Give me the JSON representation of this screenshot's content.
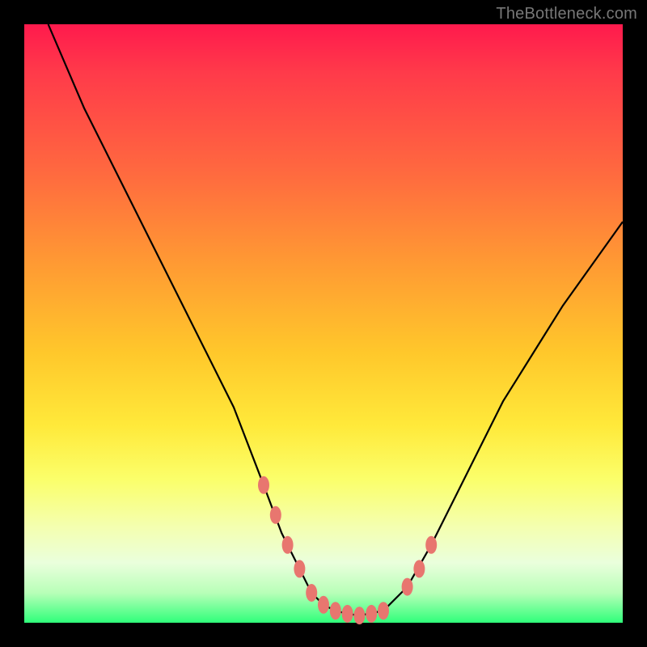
{
  "watermark": "TheBottleneck.com",
  "colors": {
    "background": "#000000",
    "gradient_stops": [
      "#ff1a4d",
      "#ff3a4a",
      "#ff6a3f",
      "#ff9a33",
      "#ffc82b",
      "#ffe93a",
      "#fbff6a",
      "#f4ffb0",
      "#eaffdc",
      "#b8ffb8",
      "#2fff7a"
    ],
    "curve": "#000000",
    "markers": "#e8766f"
  },
  "chart_data": {
    "type": "line",
    "title": "",
    "xlabel": "",
    "ylabel": "",
    "xlim": [
      0,
      100
    ],
    "ylim": [
      0,
      100
    ],
    "series": [
      {
        "name": "bottleneck-curve",
        "x": [
          4,
          10,
          15,
          20,
          25,
          30,
          35,
          40,
          43,
          46,
          48,
          50,
          52,
          54,
          56,
          60,
          64,
          68,
          72,
          76,
          80,
          85,
          90,
          95,
          100
        ],
        "values": [
          100,
          86,
          76,
          66,
          56,
          46,
          36,
          23,
          15,
          9,
          5,
          3,
          2,
          1.5,
          1.2,
          2,
          6,
          13,
          21,
          29,
          37,
          45,
          53,
          60,
          67
        ]
      }
    ],
    "markers": {
      "name": "highlight-points",
      "x": [
        40,
        42,
        44,
        46,
        48,
        50,
        52,
        54,
        56,
        58,
        60,
        64,
        66,
        68
      ],
      "values": [
        23,
        18,
        13,
        9,
        5,
        3,
        2,
        1.5,
        1.2,
        1.5,
        2,
        6,
        9,
        13
      ]
    }
  }
}
